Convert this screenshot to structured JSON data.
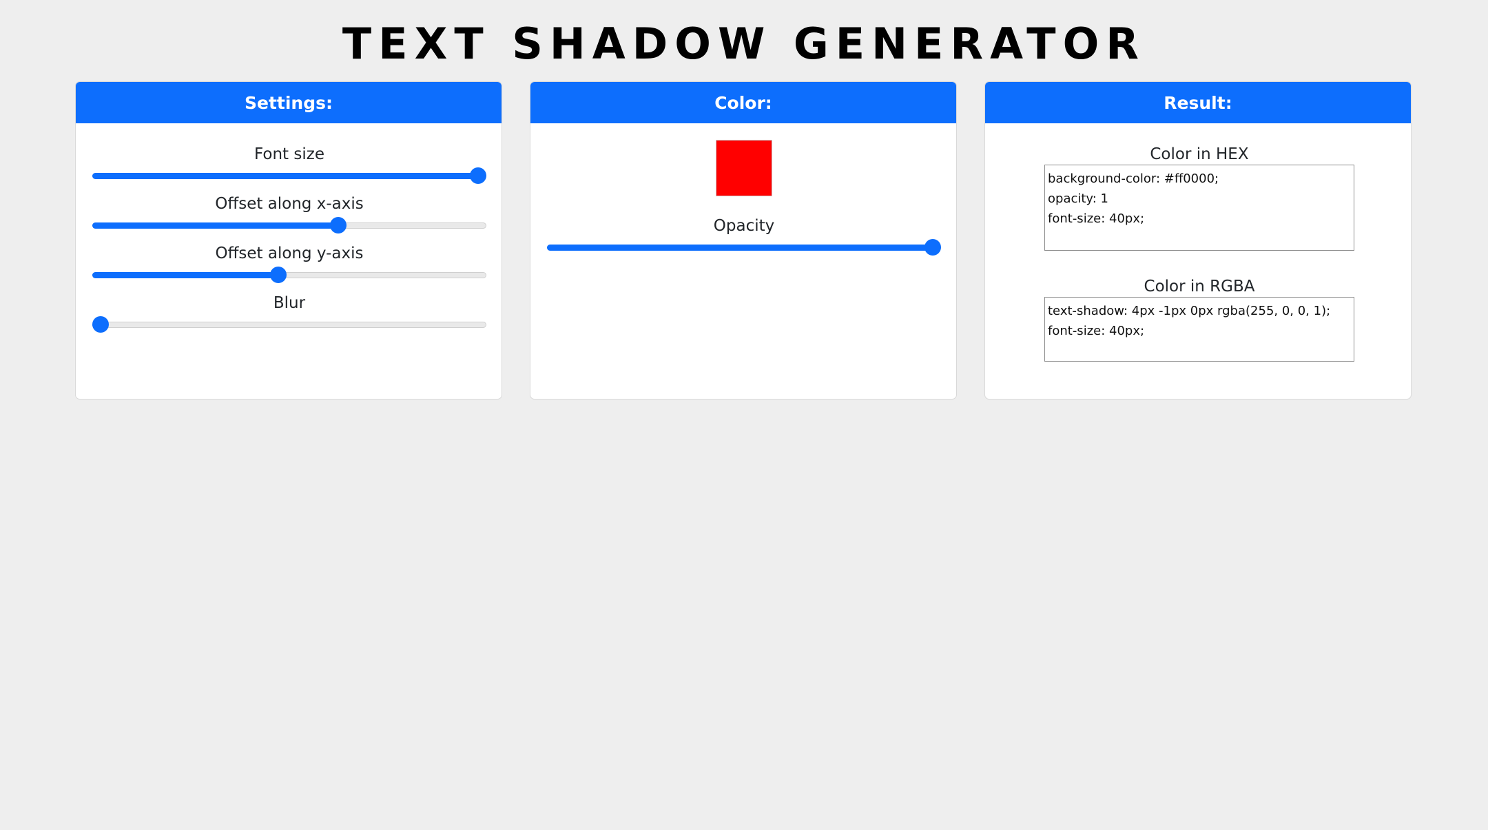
{
  "page": {
    "title": "TEXT SHADOW GENERATOR"
  },
  "colors": {
    "background": "#eeeeee",
    "accent": "#0d6efd",
    "swatch": "#ff0000"
  },
  "settings": {
    "header": "Settings:",
    "sliders": [
      {
        "label": "Font size",
        "value_fraction": 1.0
      },
      {
        "label": "Offset along x-axis",
        "value_fraction": 0.63
      },
      {
        "label": "Offset along y-axis",
        "value_fraction": 0.47
      },
      {
        "label": "Blur",
        "value_fraction": 0.0
      }
    ]
  },
  "color": {
    "header": "Color:",
    "swatch_value": "#ff0000",
    "opacity": {
      "label": "Opacity",
      "value_fraction": 1.0
    }
  },
  "result": {
    "header": "Result:",
    "hex": {
      "label": "Color in HEX",
      "lines": [
        "background-color: #ff0000;",
        "opacity: 1",
        "font-size: 40px;"
      ]
    },
    "rgba": {
      "label": "Color in RGBA",
      "lines": [
        "text-shadow: 4px -1px 0px rgba(255, 0, 0, 1);",
        "font-size: 40px;"
      ]
    }
  }
}
